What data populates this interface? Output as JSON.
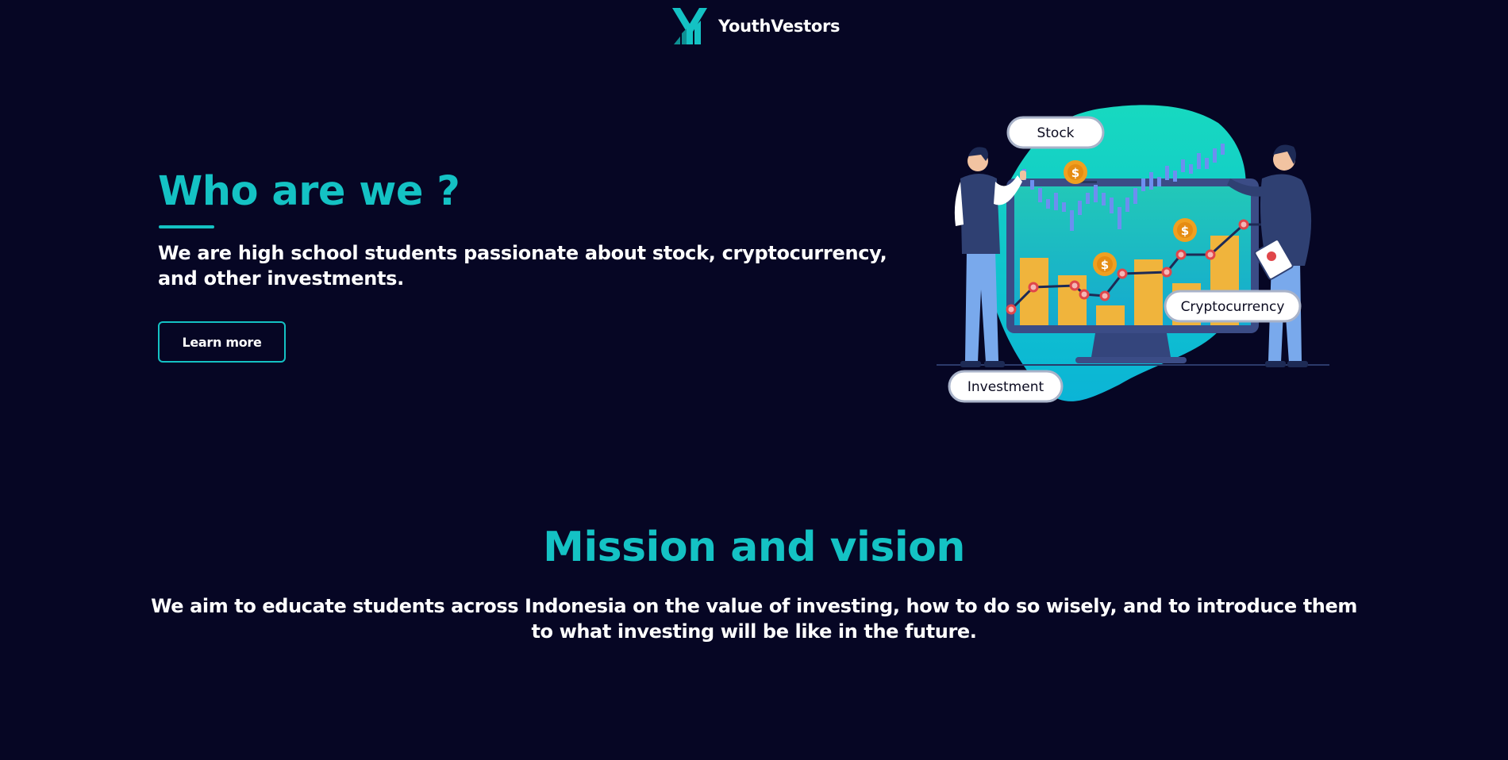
{
  "header": {
    "brand": "YouthVestors",
    "logo_icon": "youthvestors-logo-icon"
  },
  "hero": {
    "title": "Who are we ?",
    "description": "We are high school students passionate about stock, cryptocurrency, and other investments.",
    "cta_label": "Learn more",
    "illustration": {
      "labels": {
        "stock": "Stock",
        "crypto": "Cryptocurrency",
        "investment": "Investment"
      }
    }
  },
  "mission": {
    "title": "Mission and vision",
    "text": "We aim to educate students across Indonesia on the value of investing, how to do so wisely, and to introduce them to what investing will be like in the future."
  },
  "colors": {
    "background": "#060624",
    "accent": "#14c2c4",
    "text": "#ffffff"
  }
}
